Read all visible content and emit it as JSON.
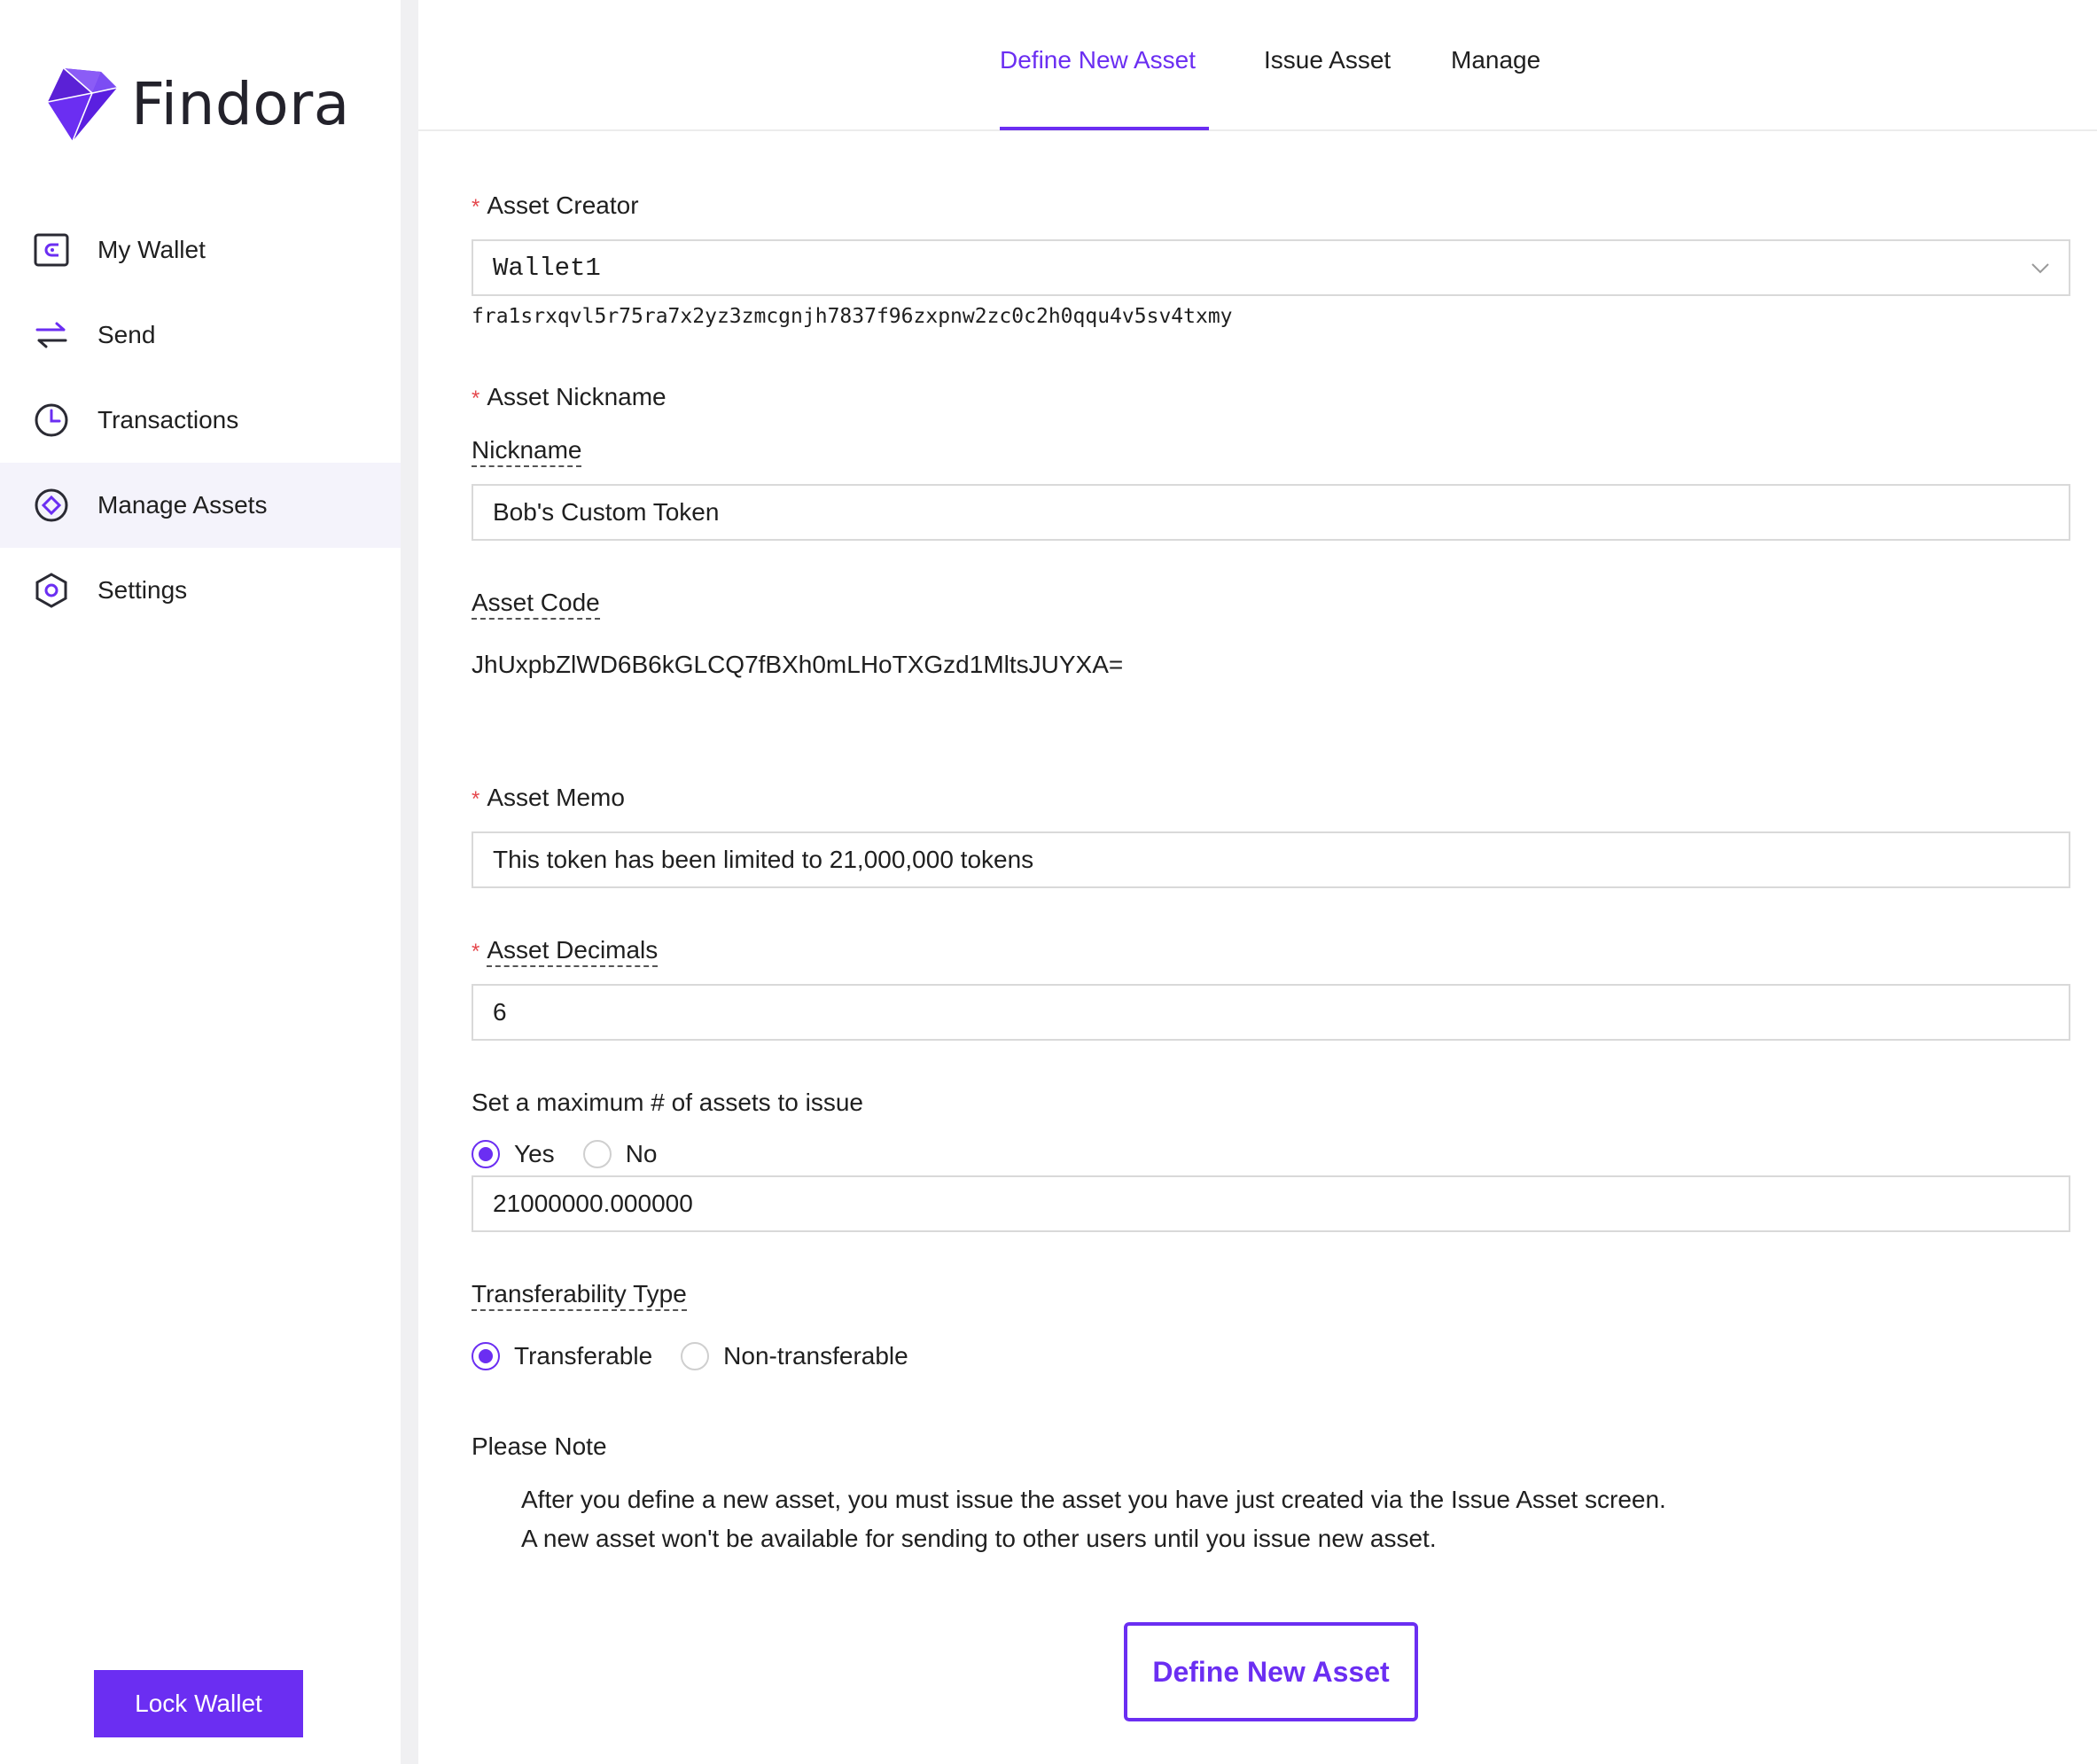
{
  "brand": {
    "name": "Findora",
    "accent": "#6b2ef2"
  },
  "sidebar": {
    "items": [
      {
        "label": "My Wallet",
        "icon": "wallet-icon"
      },
      {
        "label": "Send",
        "icon": "transfer-arrows-icon"
      },
      {
        "label": "Transactions",
        "icon": "clock-icon"
      },
      {
        "label": "Manage Assets",
        "icon": "asset-diamond-icon",
        "active": true
      },
      {
        "label": "Settings",
        "icon": "hexagon-settings-icon"
      }
    ],
    "lock_label": "Lock Wallet"
  },
  "tabs": [
    {
      "label": "Define New Asset",
      "active": true
    },
    {
      "label": "Issue Asset"
    },
    {
      "label": "Manage"
    }
  ],
  "form": {
    "creator": {
      "label": "Asset Creator",
      "value": "Wallet1",
      "address": "fra1srxqvl5r75ra7x2yz3zmcgnjh7837f96zxpnw2zc0c2h0qqu4v5sv4txmy"
    },
    "nickname": {
      "label": "Asset Nickname",
      "sublabel": "Nickname",
      "value": "Bob's Custom Token"
    },
    "code": {
      "label": "Asset Code",
      "value": "JhUxpbZlWD6B6kGLCQ7fBXh0mLHoTXGzd1MltsJUYXA="
    },
    "memo": {
      "label": "Asset Memo",
      "value": "This token has been limited to 21,000,000 tokens"
    },
    "decimals": {
      "label": "Asset Decimals",
      "value": "6"
    },
    "max_assets": {
      "label": "Set a maximum # of assets to issue",
      "options": [
        "Yes",
        "No"
      ],
      "selected": "Yes",
      "value": "21000000.000000"
    },
    "transferability": {
      "label": "Transferability Type",
      "options": [
        "Transferable",
        "Non-transferable"
      ],
      "selected": "Transferable"
    },
    "note": {
      "title": "Please Note",
      "lines": [
        "After you define a new asset, you must issue the asset you have just created via the Issue Asset screen.",
        "A new asset won't be available for sending to other users until you issue new asset."
      ]
    },
    "submit_label": "Define New Asset"
  }
}
